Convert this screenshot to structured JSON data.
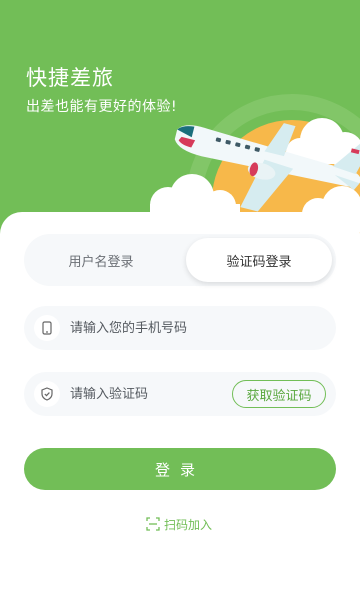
{
  "hero": {
    "title": "快捷差旅",
    "subtitle": "出差也能有更好的体验!"
  },
  "login_tabs": [
    {
      "label": "用户名登录",
      "active": false
    },
    {
      "label": "验证码登录",
      "active": true
    }
  ],
  "phone_field": {
    "icon": "phone-icon",
    "placeholder": "请输入您的手机号码",
    "value": ""
  },
  "code_field": {
    "icon": "shield-check-icon",
    "placeholder": "请输入验证码",
    "value": "",
    "get_code_label": "获取验证码"
  },
  "login_button": {
    "label": "登录"
  },
  "scan_link": {
    "icon": "scan-icon",
    "label": "扫码加入"
  },
  "colors": {
    "accent": "#72be57",
    "field_bg": "#f6f8fa",
    "sun": "#f7b84a"
  }
}
